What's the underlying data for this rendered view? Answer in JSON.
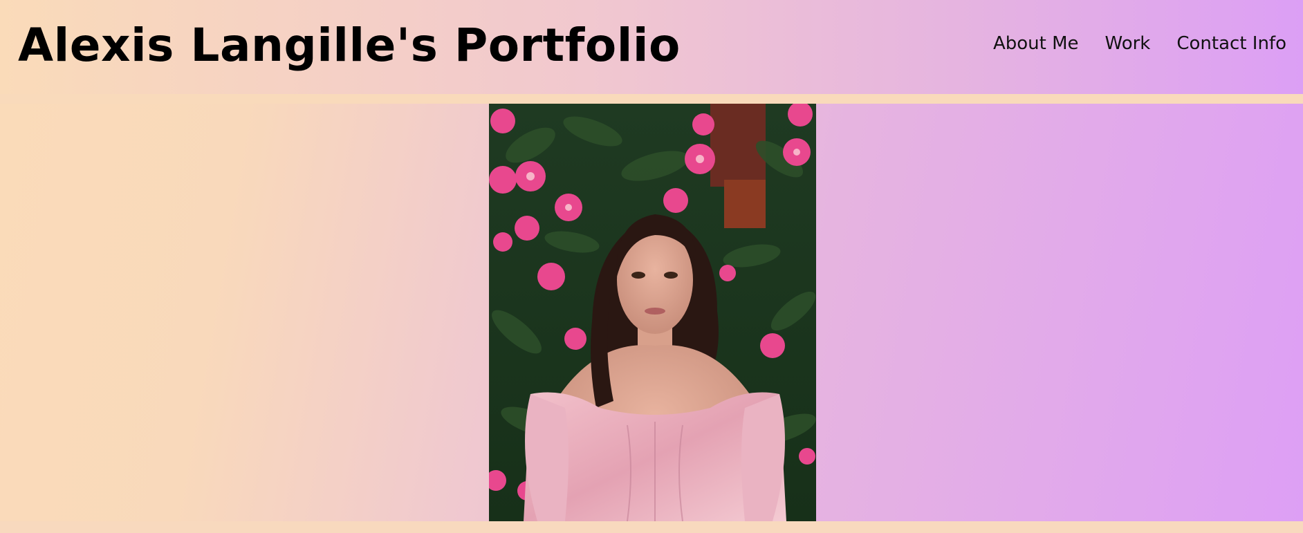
{
  "header": {
    "title": "Alexis Langille's Portfolio"
  },
  "nav": {
    "items": [
      {
        "label": "About Me",
        "name": "nav-about-me"
      },
      {
        "label": "Work",
        "name": "nav-work"
      },
      {
        "label": "Contact Info",
        "name": "nav-contact-info"
      }
    ]
  },
  "colors": {
    "gradient_start": "#fadbb9",
    "gradient_end": "#dc9ff5",
    "text": "#000000"
  },
  "main": {
    "photo_icon": "portrait-photo"
  }
}
